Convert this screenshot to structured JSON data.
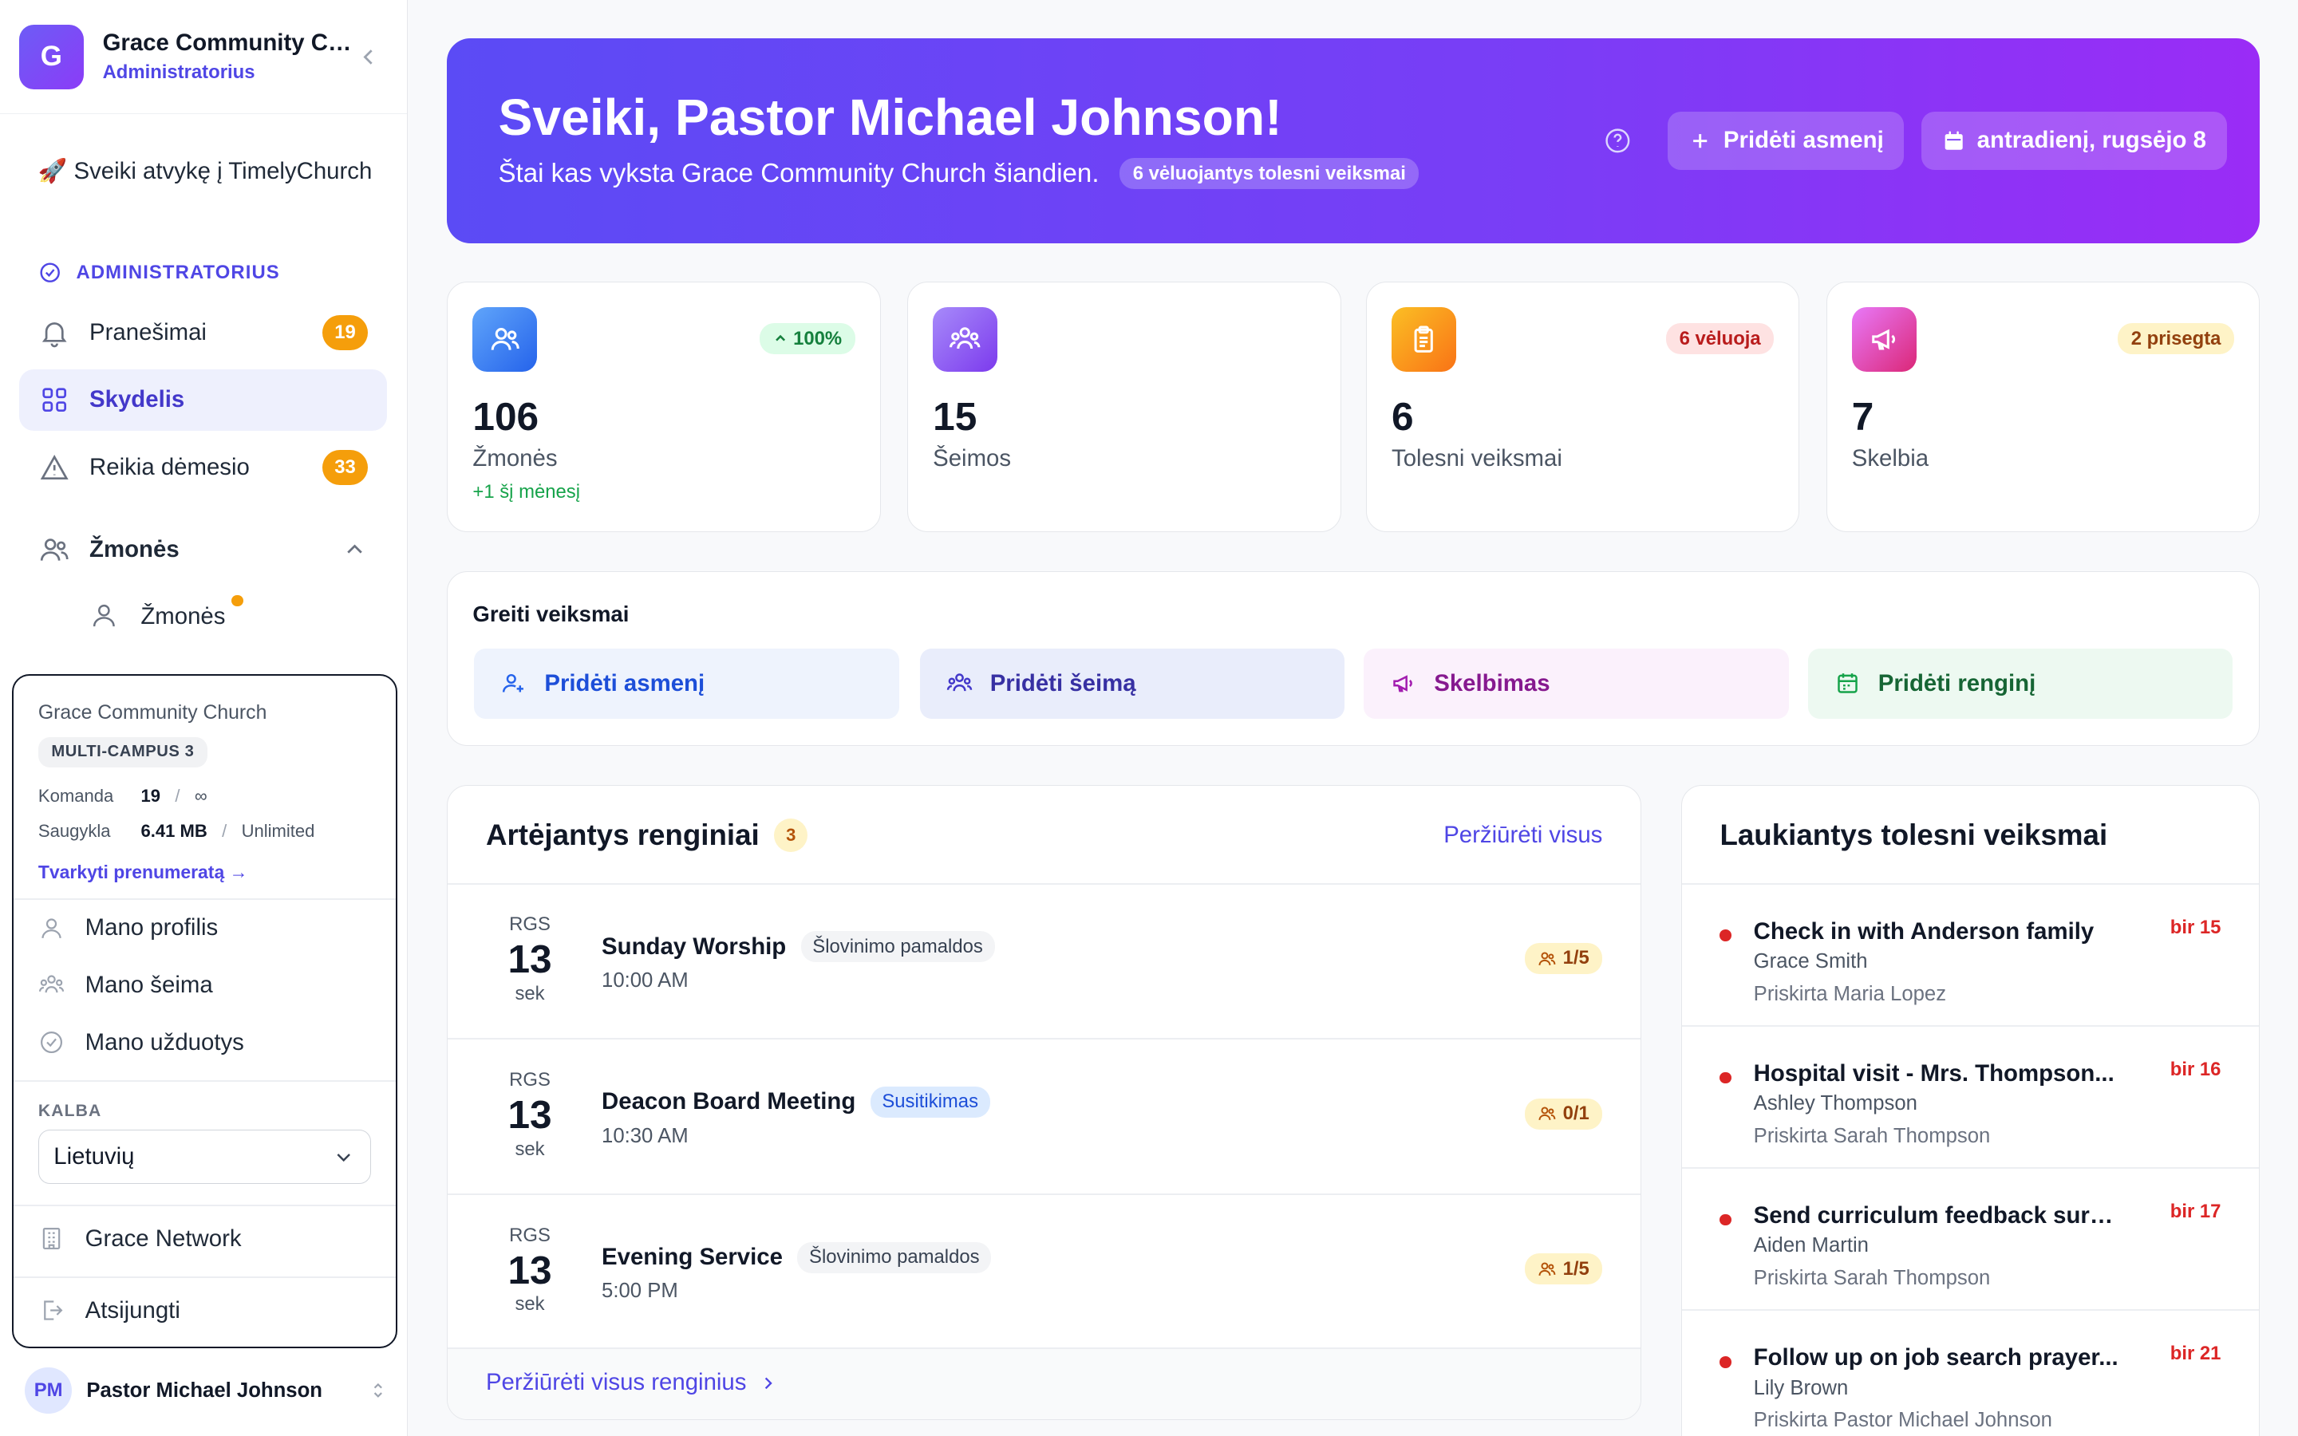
{
  "sidebar": {
    "logo_letter": "G",
    "org_name": "Grace Community Church",
    "org_role": "Administratorius",
    "welcome": "🚀 Sveiki atvykę į TimelyChurch",
    "section_label": "ADMINISTRATORIUS",
    "items": [
      {
        "label": "Pranešimai",
        "badge": "19",
        "icon": "bell-icon"
      },
      {
        "label": "Skydelis",
        "icon": "grid-icon",
        "active": true
      },
      {
        "label": "Reikia dėmesio",
        "badge": "33",
        "icon": "warning-icon"
      },
      {
        "label": "Žmonės",
        "icon": "users-icon",
        "expanded": true
      }
    ],
    "subitems": [
      {
        "label": "Žmonės",
        "icon": "user-icon"
      }
    ],
    "user": {
      "initials": "PM",
      "name": "Pastor Michael Johnson"
    }
  },
  "popover": {
    "org": "Grace Community Church",
    "plan": "MULTI-CAMPUS 3",
    "team_label": "Komanda",
    "team_used": "19",
    "team_limit": "∞",
    "storage_label": "Saugykla",
    "storage_used": "6.41 MB",
    "storage_limit": "Unlimited",
    "subscription_link": "Tvarkyti prenumeratą →",
    "menu": [
      {
        "label": "Mano profilis",
        "icon": "user-icon"
      },
      {
        "label": "Mano šeima",
        "icon": "family-icon"
      },
      {
        "label": "Mano užduotys",
        "icon": "check-circle-icon"
      }
    ],
    "language_label": "KALBA",
    "language_value": "Lietuvių",
    "network": "Grace Network",
    "logout": "Atsijungti"
  },
  "hero": {
    "title": "Sveiki, Pastor Michael Johnson!",
    "subtitle": "Štai kas vyksta Grace Community Church šiandien.",
    "pill": "6 vėluojantys tolesni veiksmai",
    "add_person": "Pridėti asmenį",
    "date": "antradienį, rugsėjo 8"
  },
  "stats": [
    {
      "value": "106",
      "label": "Žmonės",
      "tag": "100%",
      "extra": "+1 šį mėnesį",
      "color": "#3b82f6"
    },
    {
      "value": "15",
      "label": "Šeimos",
      "color": "#8b5cf6"
    },
    {
      "value": "6",
      "label": "Tolesni veiksmai",
      "tag": "6 vėluoja",
      "color": "#f59e0b"
    },
    {
      "value": "7",
      "label": "Skelbia",
      "tag": "2 prisegta",
      "color": "#d946ef"
    }
  ],
  "quick_actions": {
    "title": "Greiti veiksmai",
    "items": [
      {
        "label": "Pridėti asmenį",
        "icon": "user-plus-icon"
      },
      {
        "label": "Pridėti šeimą",
        "icon": "family-icon"
      },
      {
        "label": "Skelbimas",
        "icon": "megaphone-icon"
      },
      {
        "label": "Pridėti renginį",
        "icon": "calendar-icon"
      }
    ]
  },
  "events": {
    "title": "Artėjantys renginiai",
    "count": "3",
    "view_all": "Peržiūrėti visus",
    "footer": "Peržiūrėti visus renginius",
    "items": [
      {
        "month": "RGS",
        "day": "13",
        "weekday": "sek",
        "title": "Sunday Worship",
        "tag": "Šlovinimo pamaldos",
        "time": "10:00 AM",
        "capacity": "1/5"
      },
      {
        "month": "RGS",
        "day": "13",
        "weekday": "sek",
        "title": "Deacon Board Meeting",
        "tag": "Susitikimas",
        "time": "10:30 AM",
        "capacity": "0/1"
      },
      {
        "month": "RGS",
        "day": "13",
        "weekday": "sek",
        "title": "Evening Service",
        "tag": "Šlovinimo pamaldos",
        "time": "5:00 PM",
        "capacity": "1/5"
      }
    ]
  },
  "followups": {
    "title": "Laukiantys tolesni veiksmai",
    "items": [
      {
        "title": "Check in with Anderson family",
        "person": "Grace Smith",
        "assigned": "Priskirta Maria Lopez",
        "due": "bir 15"
      },
      {
        "title": "Hospital visit - Mrs. Thompson...",
        "person": "Ashley Thompson",
        "assigned": "Priskirta Sarah Thompson",
        "due": "bir 16"
      },
      {
        "title": "Send curriculum feedback survey",
        "person": "Aiden Martin",
        "assigned": "Priskirta Sarah Thompson",
        "due": "bir 17"
      },
      {
        "title": "Follow up on job search prayer...",
        "person": "Lily Brown",
        "assigned": "Priskirta Pastor Michael Johnson",
        "due": "bir 21"
      }
    ]
  }
}
